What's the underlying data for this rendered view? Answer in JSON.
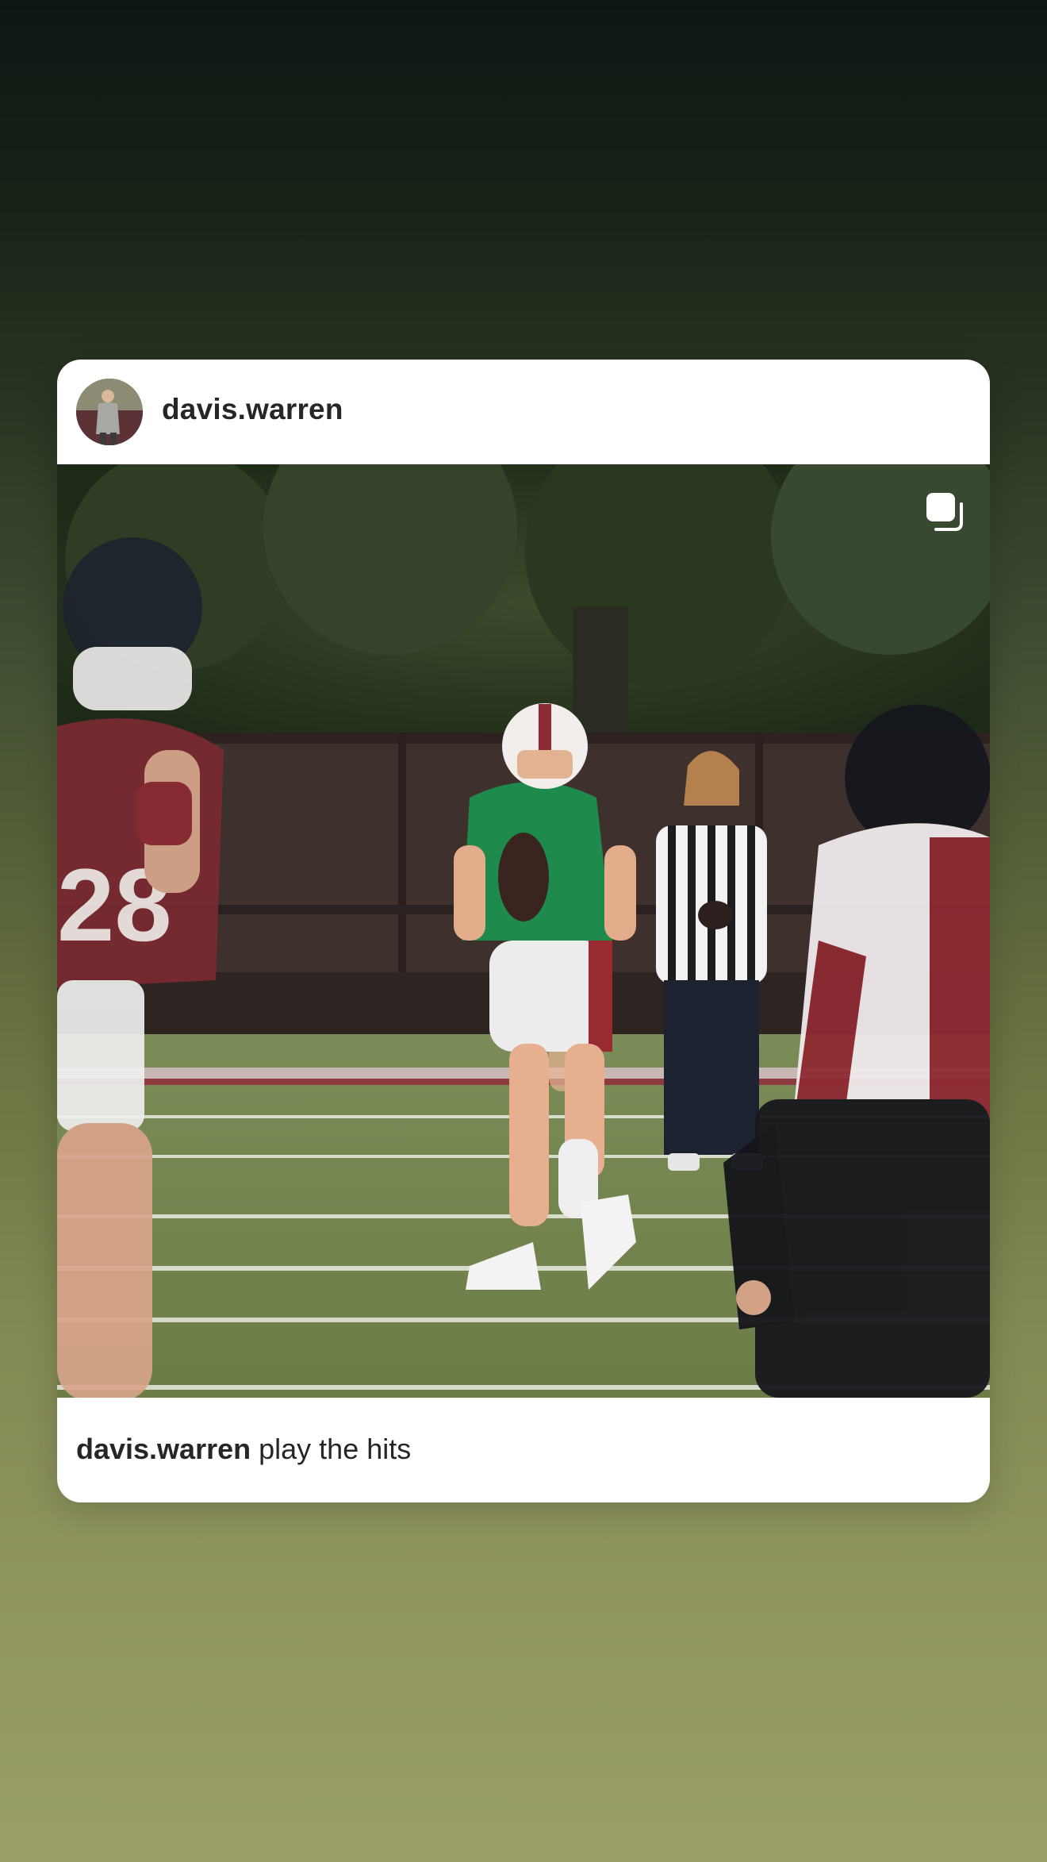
{
  "post": {
    "username": "davis.warren",
    "caption_user": "davis.warren",
    "caption_text": "play the hits",
    "avatar_icon": "profile-photo",
    "multi_image_icon": "carousel-icon"
  },
  "colors": {
    "card_background": "#ffffff",
    "text_primary": "#262626",
    "background_top": "#0d1612",
    "background_bottom": "#9ba069"
  }
}
